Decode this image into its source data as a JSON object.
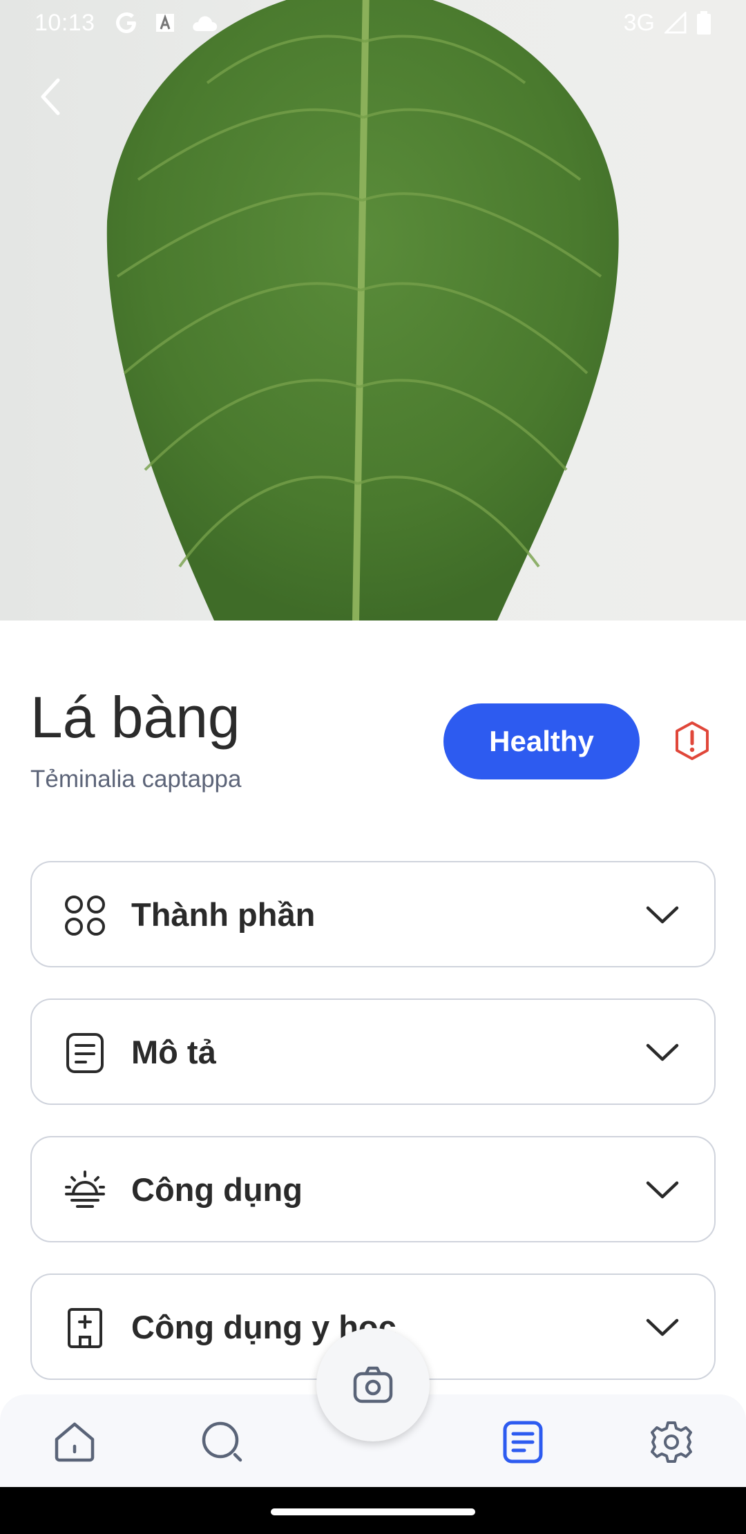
{
  "status_bar": {
    "time": "10:13",
    "network": "3G",
    "icons": [
      "google-g-icon",
      "font-a-icon",
      "cloud-icon",
      "signal-icon",
      "battery-icon"
    ]
  },
  "hero": {
    "description_icon": "back-chevron-icon"
  },
  "plant": {
    "name": "Lá bàng",
    "scientific_name": "Tẻminalia captappa",
    "status_label": "Healthy"
  },
  "sections": [
    {
      "label": "Thành phần",
      "icon": "grid-icon"
    },
    {
      "label": "Mô tả",
      "icon": "document-icon"
    },
    {
      "label": "Công dụng",
      "icon": "sunrise-icon"
    },
    {
      "label": "Công dụng y học",
      "icon": "hospital-icon"
    }
  ],
  "bottom_nav": {
    "items": [
      "home-icon",
      "search-icon",
      "camera-icon",
      "document-icon",
      "settings-icon"
    ],
    "active": "document-icon"
  },
  "colors": {
    "accent": "#2d5bf0",
    "alert": "#e0473a",
    "text": "#2a2a2a",
    "subtitle": "#5c6478"
  }
}
